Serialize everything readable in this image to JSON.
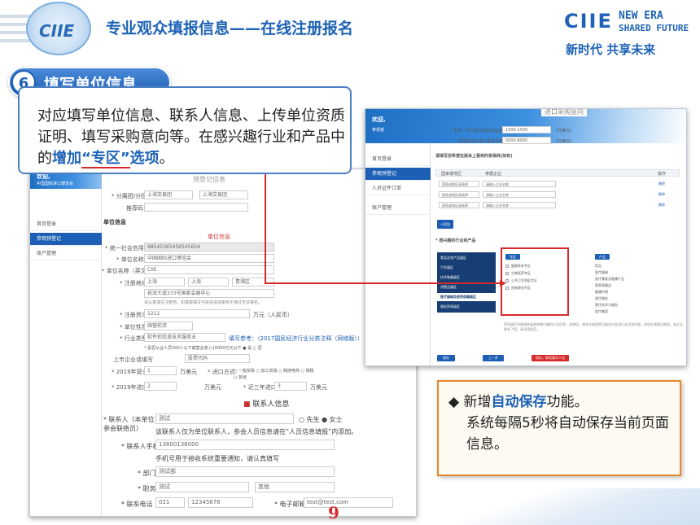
{
  "header": {
    "title": "专业观众填报信息——在线注册报名",
    "brand": "CIIE",
    "new_era": "NEW ERA",
    "shared_future": "SHARED FUTURE",
    "slogan": "新时代  共享未来",
    "logo_text": "CIIE"
  },
  "step": {
    "number": "6",
    "label": "填写单位信息"
  },
  "description": {
    "part1": "对应填写单位信息、联系人信息、上传单位资质证明、填写采购意向等。在感兴趣行业和产品中的",
    "highlight1": "增加",
    "highlight2": "“专区”",
    "highlight3": "选项",
    "end": "。"
  },
  "tip": {
    "bullet": "◆",
    "pre": "新增",
    "highlight": "自动保存",
    "post": "功能。",
    "line2": "系统每隔5秒将自动保存当前页面信息。"
  },
  "page_number": "9",
  "left_shot": {
    "welcome": "欢迎,",
    "welcome_sub": "中国国际进口博览会",
    "menu": [
      "首页登录",
      "参观预登记",
      "账户管理"
    ],
    "section_pre": "预登记信息",
    "fields": {
      "branch_label": "* 分展团/分团",
      "branch_v1": "上海交易团",
      "branch_v2": "上海交易团",
      "pass_label": "推荐码",
      "unit_info": "单位信息",
      "unit_info_icon_label": "单位信息",
      "credit_label": "* 统一社会信用代码",
      "credit_value": "98545365456545654",
      "name_label": "* 单位名称",
      "name_value": "中国国际进口博览会",
      "name_en_label": "* 单位名称（英文）",
      "name_en_value": "CIIE",
      "addr_label": "* 注册地址",
      "addr_v1": "上海",
      "addr_v2": "上海",
      "addr_v3": "青浦区",
      "addr_detail": "崧泽大道333号国家会展中心",
      "addr_hint": "请认真填写注册地，如填报填写可能会造成审核不通过无法报名。",
      "capital_label": "* 注册资本",
      "capital_value": "1212",
      "capital_unit": "万元（人民币）",
      "nature_label": "* 单位性质",
      "nature_value": "国营前资",
      "industry_label": "* 行业类型",
      "industry_value": "软件和信息技术服务业",
      "industry_ref": "填写参考：（2017国民经济行业分类注释（网络版））",
      "employee_hint": "* 是否从业人员300人以下或营业收入10000万元以下 ● 是  ○ 否",
      "listed_label": "上市企业请填写",
      "listed_value": "股票代码",
      "rev_label": "* 2019年营业额",
      "rev_value": "1",
      "rev_unit": "万美元",
      "import_label": "* 进口方式",
      "import_opts": "○ 一般贸易  ○ 加工贸易  ○ 跨境电商  ○ 保税",
      "import_other": "○ 其他",
      "imp2019_label": "* 2019年进口额",
      "imp2019_value": "2",
      "imp2019_unit": "万美元",
      "imp3_label": "* 近三年进口总额",
      "imp3_value": "3",
      "imp3_unit": "万美元"
    },
    "contact": {
      "title": "联系人信息",
      "person_label": "* 联系人（本单位参会联络员）",
      "person_value": "测试",
      "gender": "○ 先生  ● 女士",
      "person_hint": "该联系人仅为单位联系人，参会人员信息请在“人员信息填报”内添加。",
      "phone_label": "* 联系人手机",
      "phone_value": "13800138000",
      "phone_hint": "手机号用于接收系统重要通知，请认真填写",
      "dept_label": "* 部门",
      "dept_value": "测试部",
      "post_label": "* 职务",
      "post_value": "测试",
      "post_other": "其他",
      "tel_label": "* 联系电话",
      "tel_v1": "021",
      "tel_v2": "12345678",
      "email_label": "* 电子邮箱",
      "email_value": "test@test.com"
    }
  },
  "right_shot": {
    "welcome": "欢迎,",
    "welcome_sub": "参观者",
    "menu": [
      "首页登录",
      "参观预登记",
      "人员证件订单",
      "账户管理"
    ],
    "section": "进口采购意向",
    "q1_label": "* 未来一年内进口采购商品金额",
    "q1_value": "1000-1500",
    "q1_unit": "(万美元)",
    "q2_label": "* 未来五年内进口采购总金额",
    "q2_value": "5000-8000",
    "q2_unit": "(万美元)",
    "table_title": "请填写您希望在展会上看到的参展商(如有)",
    "cols": [
      "国家或地区",
      "参展企业",
      "操作"
    ],
    "row_ph1": "国家或地区请选择",
    "row_ph2": "请输入企业名称",
    "row_op": "删除",
    "add": "+添加",
    "interest_title": "* 感兴趣的行业和产品",
    "zones": [
      "食品及农产品展区",
      "汽车展区",
      "技术装备展区",
      "消费品展区",
      "医疗器械及医药保健展区",
      "服务贸易展区"
    ],
    "col_zone": "专区",
    "zone_items": [
      "健康养老专区",
      "生物医药专区",
      "公共卫生防疫专区",
      "创新孵化专区"
    ],
    "col_prod": "产品",
    "prod_items": [
      "药品",
      "医疗器械",
      "医疗康复及健康产品",
      "营养保健品",
      "健康护理",
      "医疗服务",
      "医疗技术与服务",
      "医疗美容"
    ],
    "note": "您所填写的邀请参展商和感兴趣的产品信息，进博局、相关交易团将可能会对此进行关注和对接。如您在预登记期间，有企业联系了您，请注意防范。",
    "btn_prev": "保存",
    "btn_next": "上一步",
    "btn_submit": "保存，继续填写人员"
  }
}
